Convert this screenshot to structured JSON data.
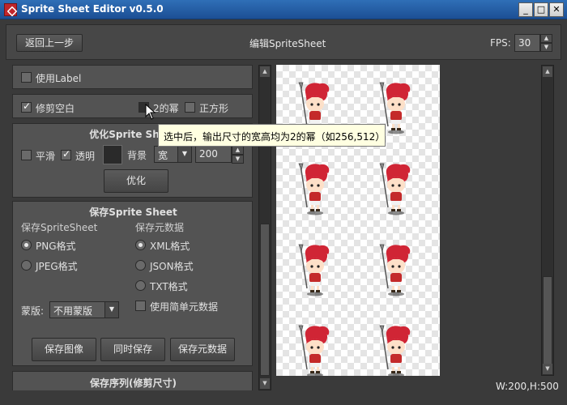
{
  "window": {
    "title": "Sprite Sheet Editor v0.5.0",
    "min": "_",
    "max": "□",
    "close": "✕"
  },
  "header": {
    "back_label": "返回上一步",
    "title": "编辑SpriteSheet",
    "fps_label": "FPS:",
    "fps_value": "30"
  },
  "options": {
    "use_label": {
      "label": "使用Label",
      "checked": false
    },
    "trim": {
      "label": "修剪空白",
      "checked": true
    },
    "pow2": {
      "label": "2的幂",
      "checked": false
    },
    "square": {
      "label": "正方形",
      "checked": false
    }
  },
  "optimize": {
    "title": "优化Sprite Sheet",
    "smooth": {
      "label": "平滑",
      "checked": false
    },
    "transparent": {
      "label": "透明",
      "checked": true
    },
    "bg_label": "背景",
    "size_mode": "宽",
    "size_value": "200",
    "button": "优化"
  },
  "save": {
    "title": "保存Sprite Sheet",
    "sheet_header": "保存SpriteSheet",
    "meta_header": "保存元数据",
    "png": "PNG格式",
    "jpeg": "JPEG格式",
    "xml": "XML格式",
    "json": "JSON格式",
    "txt": "TXT格式",
    "simple_meta": "使用简单元数据",
    "mask_label": "蒙版:",
    "mask_value": "不用蒙版",
    "save_image": "保存图像",
    "save_both": "同时保存",
    "save_meta": "保存元数据"
  },
  "save_seq": {
    "title": "保存序列(修剪尺寸)"
  },
  "tooltip": "选中后，输出尺寸的宽高均为2的幂（如256,512）",
  "canvas": {
    "dims": "W:200,H:500",
    "sprite_count": 8
  },
  "colors": {
    "hair": "#d02535",
    "skin": "#fde0c8",
    "body": "#c42a2a",
    "accent": "#2f6fb7"
  }
}
